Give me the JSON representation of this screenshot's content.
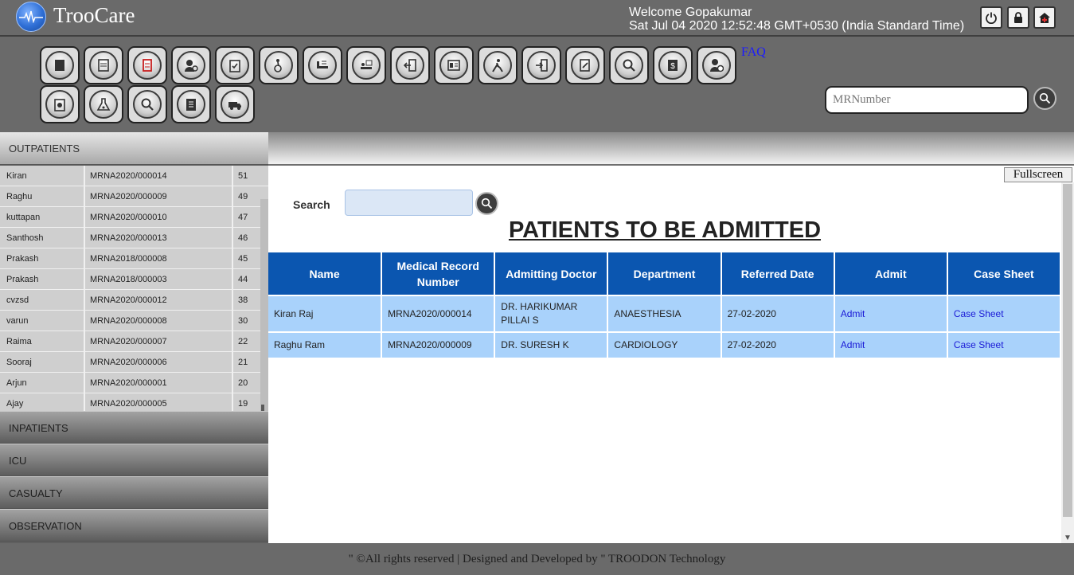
{
  "header": {
    "app_name": "TrooCare",
    "welcome": "Welcome Gopakumar",
    "datetime": "Sat Jul 04 2020 12:52:48 GMT+0530 (India Standard Time)",
    "faq_label": "FAQ",
    "mr_placeholder": "MRNumber",
    "top_buttons": [
      "power-icon",
      "lock-icon",
      "home-icon"
    ]
  },
  "toolbar_icons": [
    "document-icon",
    "notepad-icon",
    "prescription-icon",
    "user-settings-icon",
    "clipboard-check-icon",
    "wheelchair-icon",
    "ward-bed-icon",
    "patient-bed-icon",
    "transfer-icon",
    "lab-report-icon",
    "emergency-icon",
    "discharge-icon",
    "file-edit-icon",
    "search-icon",
    "billing-icon",
    "doctor-schedule-icon",
    "medicine-clipboard-icon",
    "lab-flask-icon",
    "search-icon",
    "checklist-icon",
    "ambulance-icon"
  ],
  "sidebar": {
    "outpatients_label": "OUTPATIENTS",
    "outpatients": [
      {
        "name": "Kiran",
        "mr": "MRNA2020/000014",
        "token": "51"
      },
      {
        "name": "Raghu",
        "mr": "MRNA2020/000009",
        "token": "49"
      },
      {
        "name": "kuttapan",
        "mr": "MRNA2020/000010",
        "token": "47"
      },
      {
        "name": "Santhosh",
        "mr": "MRNA2020/000013",
        "token": "46"
      },
      {
        "name": "Prakash",
        "mr": "MRNA2018/000008",
        "token": "45"
      },
      {
        "name": "Prakash",
        "mr": "MRNA2018/000003",
        "token": "44"
      },
      {
        "name": "cvzsd",
        "mr": "MRNA2020/000012",
        "token": "38"
      },
      {
        "name": "varun",
        "mr": "MRNA2020/000008",
        "token": "30"
      },
      {
        "name": "Raima",
        "mr": "MRNA2020/000007",
        "token": "22"
      },
      {
        "name": "Sooraj",
        "mr": "MRNA2020/000006",
        "token": "21"
      },
      {
        "name": "Arjun",
        "mr": "MRNA2020/000001",
        "token": "20"
      },
      {
        "name": "Ajay",
        "mr": "MRNA2020/000005",
        "token": "19"
      }
    ],
    "inpatients_label": "INPATIENTS",
    "icu_label": "ICU",
    "casualty_label": "CASUALTY",
    "observation_label": "OBSERVATION"
  },
  "main": {
    "fullscreen_label": "Fullscreen",
    "search_label": "Search",
    "title": "PATIENTS TO BE ADMITTED",
    "columns": [
      "Name",
      "Medical Record Number",
      "Admitting Doctor",
      "Department",
      "Referred Date",
      "Admit",
      "Case Sheet"
    ],
    "rows": [
      {
        "name": "Kiran Raj",
        "mr": "MRNA2020/000014",
        "doctor": "DR. HARIKUMAR PILLAI S",
        "department": "ANAESTHESIA",
        "date": "27-02-2020",
        "admit": "Admit",
        "case_sheet": "Case Sheet"
      },
      {
        "name": "Raghu Ram",
        "mr": "MRNA2020/000009",
        "doctor": "DR. SURESH K",
        "department": "CARDIOLOGY",
        "date": "27-02-2020",
        "admit": "Admit",
        "case_sheet": "Case Sheet"
      }
    ]
  },
  "footer": {
    "text": "\" ©All rights reserved | Designed and Developed by \" TROODON Technology"
  }
}
